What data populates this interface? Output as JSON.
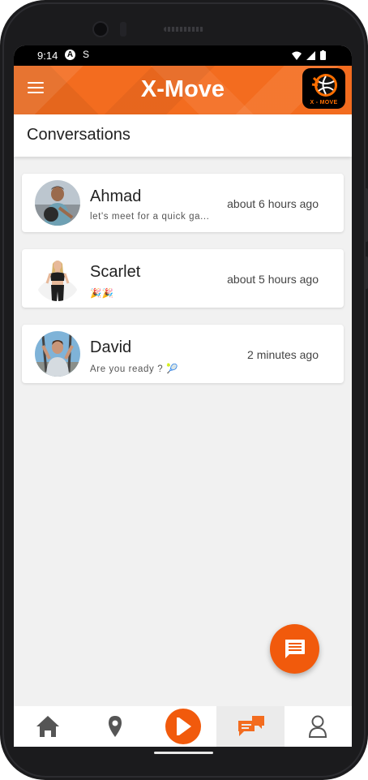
{
  "status_bar": {
    "time": "9:14",
    "badge_letter": "A",
    "notif_glyph": "S"
  },
  "app_bar": {
    "title": "X-Move",
    "logo_text": "X - MOVE"
  },
  "page": {
    "title": "Conversations"
  },
  "conversations": [
    {
      "name": "Ahmad",
      "preview": "let's meet for a quick ga...",
      "time": "about 6 hours ago"
    },
    {
      "name": "Scarlet",
      "preview": "🎉🎉",
      "time": "about 5 hours ago"
    },
    {
      "name": "David",
      "preview": "Are you ready ? 🎾",
      "time": "2 minutes ago"
    }
  ],
  "nav": {
    "items": [
      "home-icon",
      "location-pin-icon",
      "play-icon",
      "chat-bubbles-icon",
      "profile-icon"
    ],
    "active": "chat-bubbles-icon"
  },
  "colors": {
    "accent": "#f36c1f",
    "fab": "#f15a0c",
    "nav_icon": "#555555"
  }
}
